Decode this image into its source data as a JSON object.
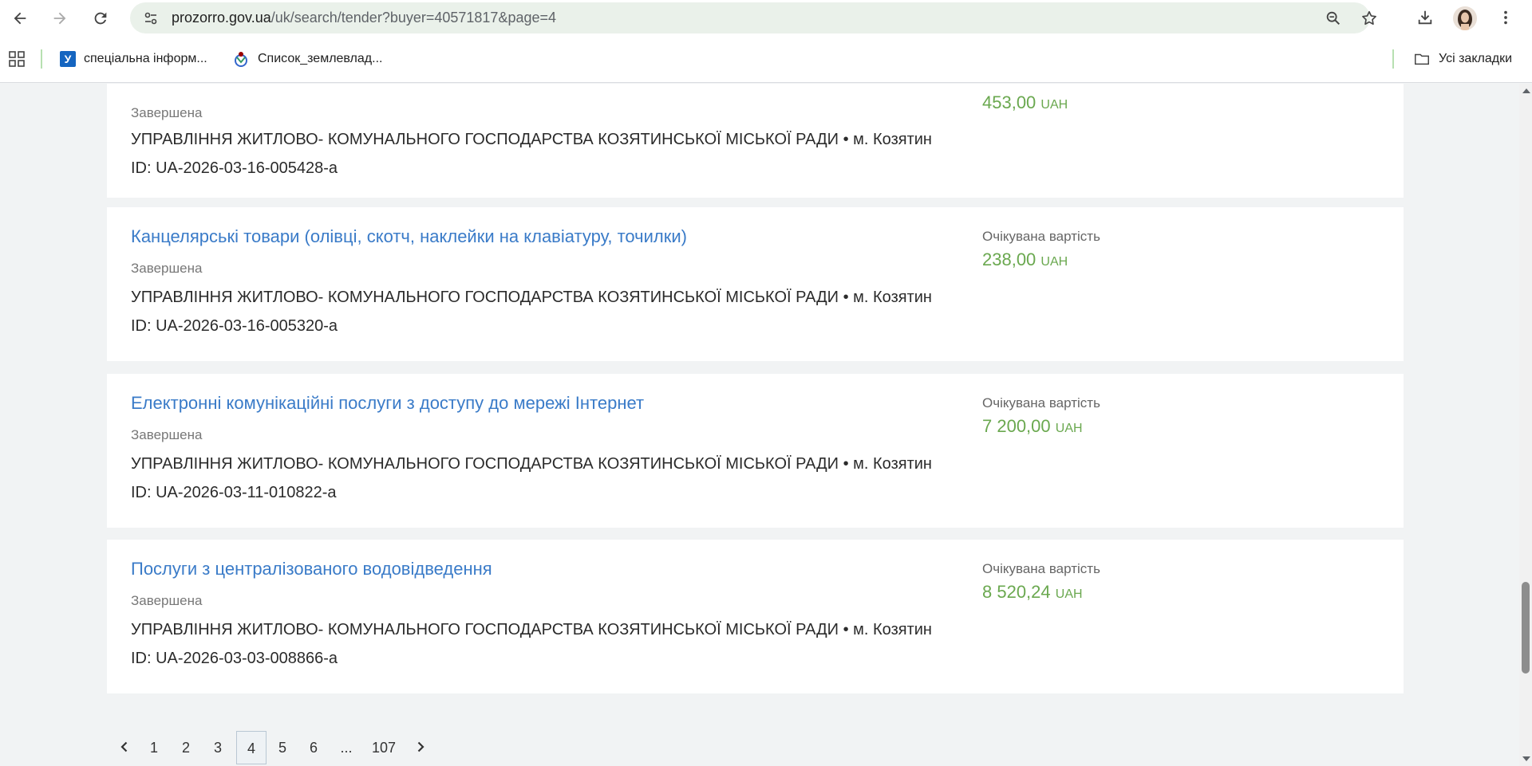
{
  "browser": {
    "url_host": "prozorro.gov.ua",
    "url_path": "/uk/search/tender?buyer=40571817&page=4",
    "bookmarks": [
      {
        "label": "спеціальна інформ...",
        "icon": "y-favicon"
      },
      {
        "label": "Список_землевлад...",
        "icon": "wikimedia-favicon"
      }
    ],
    "all_bookmarks_label": "Усі закладки"
  },
  "tenders": [
    {
      "title": "",
      "status": "Завершена",
      "buyer": "УПРАВЛІННЯ ЖИТЛОВО- КОМУНАЛЬНОГО ГОСПОДАРСТВА КОЗЯТИНСЬКОЇ МІСЬКОЇ РАДИ • м. Козятин",
      "id": "ID: UA-2026-03-16-005428-a",
      "price_label": "",
      "price": "453,00",
      "currency": "UAH"
    },
    {
      "title": "Канцелярські товари (олівці, скотч, наклейки на клавіатуру, точилки)",
      "status": "Завершена",
      "buyer": "УПРАВЛІННЯ ЖИТЛОВО- КОМУНАЛЬНОГО ГОСПОДАРСТВА КОЗЯТИНСЬКОЇ МІСЬКОЇ РАДИ • м. Козятин",
      "id": "ID: UA-2026-03-16-005320-a",
      "price_label": "Очікувана вартість",
      "price": "238,00",
      "currency": "UAH"
    },
    {
      "title": "Електронні комунікаційні послуги з доступу до мережі Інтернет",
      "status": "Завершена",
      "buyer": "УПРАВЛІННЯ ЖИТЛОВО- КОМУНАЛЬНОГО ГОСПОДАРСТВА КОЗЯТИНСЬКОЇ МІСЬКОЇ РАДИ • м. Козятин",
      "id": "ID: UA-2026-03-11-010822-a",
      "price_label": "Очікувана вартість",
      "price": "7 200,00",
      "currency": "UAH"
    },
    {
      "title": "Послуги з централізованого водовідведення",
      "status": "Завершена",
      "buyer": "УПРАВЛІННЯ ЖИТЛОВО- КОМУНАЛЬНОГО ГОСПОДАРСТВА КОЗЯТИНСЬКОЇ МІСЬКОЇ РАДИ • м. Козятин",
      "id": "ID: UA-2026-03-03-008866-a",
      "price_label": "Очікувана вартість",
      "price": "8 520,24",
      "currency": "UAH"
    }
  ],
  "pagination": {
    "pages": [
      "1",
      "2",
      "3",
      "4",
      "5",
      "6",
      "...",
      "107"
    ],
    "current": "4"
  },
  "colors": {
    "link": "#3a7bc8",
    "price": "#6aa84f",
    "page_bg": "#f1f3f4",
    "omnibox_bg": "#eaf1ea"
  }
}
